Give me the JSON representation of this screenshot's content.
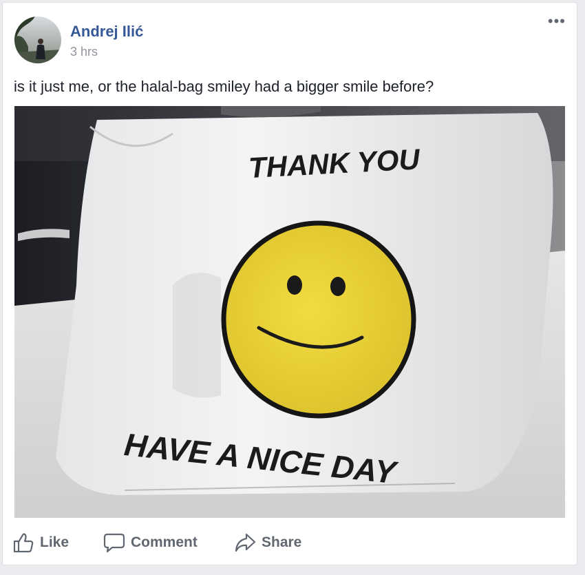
{
  "post": {
    "author": "Andrej Ilić",
    "timestamp": "3 hrs",
    "more_label": "•••",
    "text": "is it just me, or the halal-bag smiley had a bigger smile before?"
  },
  "photo": {
    "bag_top_text": "THANK YOU",
    "bag_bottom_text": "HAVE A NICE DAY"
  },
  "actions": {
    "like": "Like",
    "comment": "Comment",
    "share": "Share"
  },
  "colors": {
    "author_link": "#365899",
    "meta_gray": "#90949c",
    "action_gray": "#606770",
    "smiley_yellow": "#f0d63a"
  }
}
